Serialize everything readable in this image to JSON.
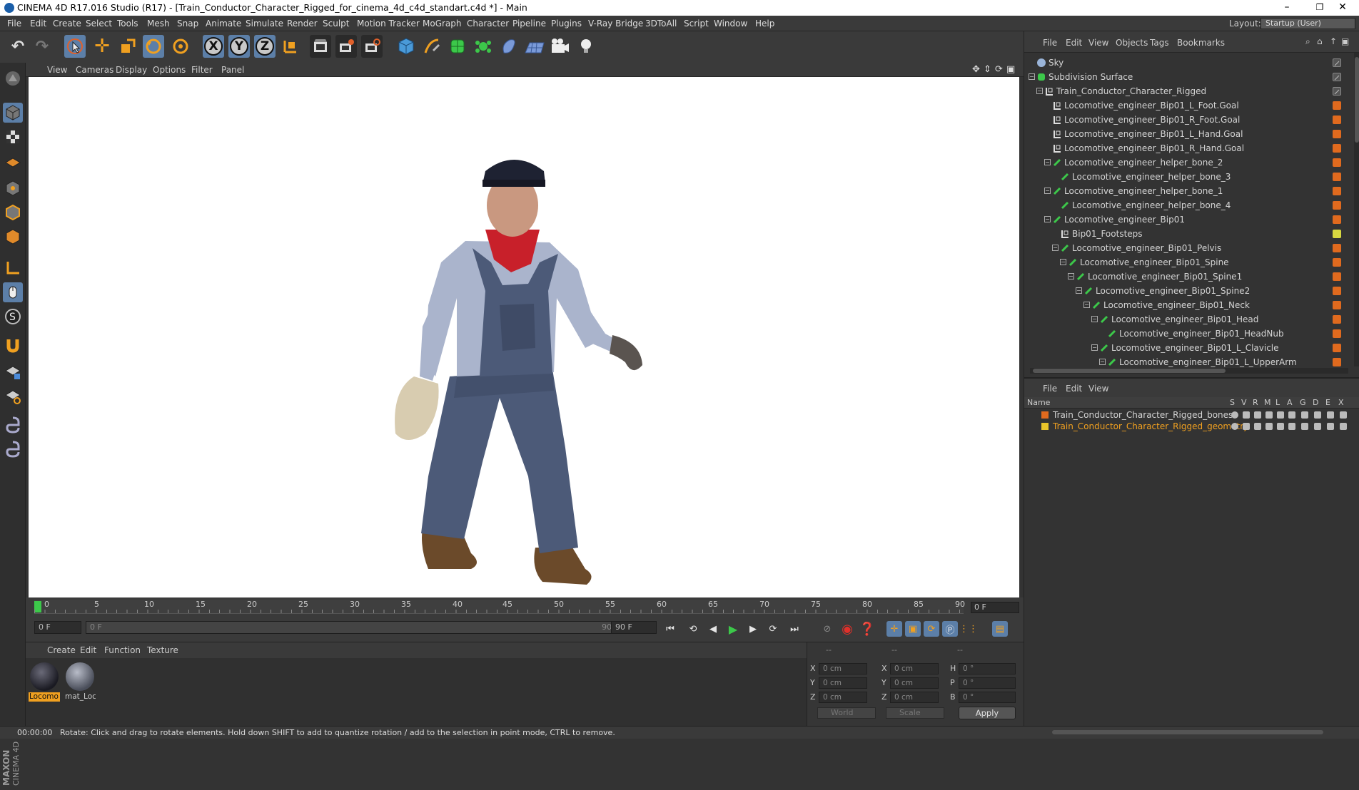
{
  "window": {
    "title": "CINEMA 4D R17.016 Studio (R17) - [Train_Conductor_Character_Rigged_for_cinema_4d_c4d_standart.c4d *] - Main",
    "minimize": "–",
    "restore": "❐",
    "close": "✕"
  },
  "menubar": {
    "items": [
      "File",
      "Edit",
      "Create",
      "Select",
      "Tools",
      "Mesh",
      "Snap",
      "Animate",
      "Simulate",
      "Render",
      "Sculpt",
      "Motion Tracker",
      "MoGraph",
      "Character",
      "Pipeline",
      "Plugins",
      "V-Ray Bridge",
      "3DToAll",
      "Script",
      "Window",
      "Help"
    ],
    "layout_label": "Layout:",
    "layout_value": "Startup (User)"
  },
  "toolbar": {
    "icons": [
      "undo-icon",
      "redo-icon",
      "live-select-icon",
      "move-icon",
      "scale-icon",
      "rotate-icon",
      "recent-tool-icon",
      "x-axis-icon",
      "y-axis-icon",
      "z-axis-icon",
      "coordinate-system-icon",
      "render-view-icon",
      "render-picture-viewer-icon",
      "edit-render-settings-icon",
      "cube-icon",
      "pen-icon",
      "subdivision-icon",
      "mograph-cloner-icon",
      "deformer-icon",
      "floor-icon",
      "camera-icon",
      "light-icon"
    ],
    "axis_x": "X",
    "axis_y": "Y",
    "axis_z": "Z"
  },
  "viewport_menu": {
    "items": [
      "View",
      "Cameras",
      "Display",
      "Options",
      "Filter",
      "Panel"
    ]
  },
  "timeline": {
    "ticks": [
      "0",
      "5",
      "10",
      "15",
      "20",
      "25",
      "30",
      "35",
      "40",
      "45",
      "50",
      "55",
      "60",
      "65",
      "70",
      "75",
      "80",
      "85",
      "90"
    ],
    "current_frame": "0 F"
  },
  "transport": {
    "start_field": "0 F",
    "range_start": "0 F",
    "range_end": "90 F",
    "end_field": "90 F"
  },
  "material_manager": {
    "menu": [
      "Create",
      "Edit",
      "Function",
      "Texture"
    ],
    "materials": [
      {
        "label": "Locomo",
        "selected": true
      },
      {
        "label": "mat_Loc",
        "selected": false
      }
    ]
  },
  "coordinates": {
    "header": [
      "--",
      "--",
      "--"
    ],
    "rows": [
      {
        "l1": "X",
        "v1": "0 cm",
        "l2": "X",
        "v2": "0 cm",
        "l3": "H",
        "v3": "0 °"
      },
      {
        "l1": "Y",
        "v1": "0 cm",
        "l2": "Y",
        "v2": "0 cm",
        "l3": "P",
        "v3": "0 °"
      },
      {
        "l1": "Z",
        "v1": "0 cm",
        "l2": "Z",
        "v2": "0 cm",
        "l3": "B",
        "v3": "0 °"
      }
    ],
    "space": "World",
    "mode": "Scale",
    "apply": "Apply"
  },
  "status": {
    "time": "00:00:00",
    "message": "Rotate: Click and drag to rotate elements. Hold down SHIFT to add to quantize rotation / add to the selection in point mode, CTRL to remove."
  },
  "object_manager": {
    "menu": [
      "File",
      "Edit",
      "View",
      "Objects",
      "Tags",
      "Bookmarks"
    ],
    "objects": [
      {
        "name": "Sky",
        "depth": 0,
        "icon": "sky",
        "expand": "",
        "tag": "check"
      },
      {
        "name": "Subdivision Surface",
        "depth": 0,
        "icon": "subdiv",
        "expand": "−",
        "tag": "check"
      },
      {
        "name": "Train_Conductor_Character_Rigged",
        "depth": 1,
        "icon": "null",
        "expand": "−",
        "tag": "check"
      },
      {
        "name": "Locomotive_engineer_Bip01_L_Foot.Goal",
        "depth": 2,
        "icon": "null",
        "expand": "",
        "tag": "orange"
      },
      {
        "name": "Locomotive_engineer_Bip01_R_Foot.Goal",
        "depth": 2,
        "icon": "null",
        "expand": "",
        "tag": "orange"
      },
      {
        "name": "Locomotive_engineer_Bip01_L_Hand.Goal",
        "depth": 2,
        "icon": "null",
        "expand": "",
        "tag": "orange"
      },
      {
        "name": "Locomotive_engineer_Bip01_R_Hand.Goal",
        "depth": 2,
        "icon": "null",
        "expand": "",
        "tag": "orange"
      },
      {
        "name": "Locomotive_engineer_helper_bone_2",
        "depth": 2,
        "icon": "bone",
        "expand": "−",
        "tag": "orange"
      },
      {
        "name": "Locomotive_engineer_helper_bone_3",
        "depth": 3,
        "icon": "bone",
        "expand": "",
        "tag": "orange"
      },
      {
        "name": "Locomotive_engineer_helper_bone_1",
        "depth": 2,
        "icon": "bone",
        "expand": "−",
        "tag": "orange"
      },
      {
        "name": "Locomotive_engineer_helper_bone_4",
        "depth": 3,
        "icon": "bone",
        "expand": "",
        "tag": "orange"
      },
      {
        "name": "Locomotive_engineer_Bip01",
        "depth": 2,
        "icon": "bone",
        "expand": "−",
        "tag": "orange"
      },
      {
        "name": "Bip01_Footsteps",
        "depth": 3,
        "icon": "null",
        "expand": "",
        "tag": "yellow"
      },
      {
        "name": "Locomotive_engineer_Bip01_Pelvis",
        "depth": 3,
        "icon": "bone",
        "expand": "−",
        "tag": "orange"
      },
      {
        "name": "Locomotive_engineer_Bip01_Spine",
        "depth": 4,
        "icon": "bone",
        "expand": "−",
        "tag": "orange"
      },
      {
        "name": "Locomotive_engineer_Bip01_Spine1",
        "depth": 5,
        "icon": "bone",
        "expand": "−",
        "tag": "orange"
      },
      {
        "name": "Locomotive_engineer_Bip01_Spine2",
        "depth": 6,
        "icon": "bone",
        "expand": "−",
        "tag": "orange"
      },
      {
        "name": "Locomotive_engineer_Bip01_Neck",
        "depth": 7,
        "icon": "bone",
        "expand": "−",
        "tag": "orange"
      },
      {
        "name": "Locomotive_engineer_Bip01_Head",
        "depth": 8,
        "icon": "bone",
        "expand": "−",
        "tag": "orange"
      },
      {
        "name": "Locomotive_engineer_Bip01_HeadNub",
        "depth": 9,
        "icon": "bone",
        "expand": "",
        "tag": "orange"
      },
      {
        "name": "Locomotive_engineer_Bip01_L_Clavicle",
        "depth": 8,
        "icon": "bone",
        "expand": "−",
        "tag": "orange"
      },
      {
        "name": "Locomotive_engineer_Bip01_L_UpperArm",
        "depth": 9,
        "icon": "bone",
        "expand": "−",
        "tag": "orange"
      }
    ]
  },
  "layer_manager": {
    "menu": [
      "File",
      "Edit",
      "View"
    ],
    "columns": [
      "Name",
      "S",
      "V",
      "R",
      "M",
      "L",
      "A",
      "G",
      "D",
      "E",
      "X"
    ],
    "layers": [
      {
        "name": "Train_Conductor_Character_Rigged_bones",
        "color": "#e06a1e",
        "active": false
      },
      {
        "name": "Train_Conductor_Character_Rigged_geometry",
        "color": "#e8c42a",
        "active": true
      }
    ]
  },
  "colors": {
    "accent_blue": "#5c7fa8",
    "tag_orange": "#e06a1e",
    "tag_yellow": "#d8d840",
    "bone_green": "#3cc84a",
    "active_layer_text": "#f0a020"
  }
}
